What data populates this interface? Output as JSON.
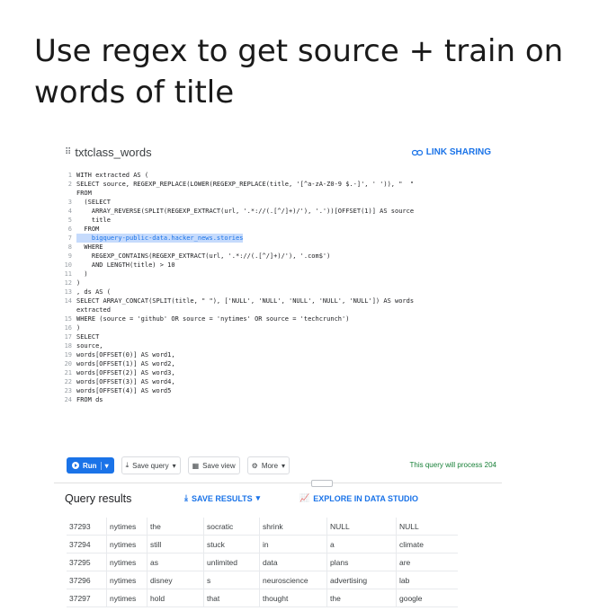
{
  "slide": {
    "title_line1": "Use regex to get source + train on",
    "title_line2": "words of title"
  },
  "editor": {
    "title": "txtclass_words",
    "link_sharing": "LINK SHARING",
    "code_lines": [
      {
        "n": "1",
        "t": "WITH extracted AS ("
      },
      {
        "n": "2",
        "t": "SELECT source, REGEXP_REPLACE(LOWER(REGEXP_REPLACE(title, '[^a-zA-Z0-9 $.-]', ' ')), \"  \""
      },
      {
        "n": "",
        "t": "FROM"
      },
      {
        "n": "3",
        "t": "  (SELECT"
      },
      {
        "n": "4",
        "t": "    ARRAY_REVERSE(SPLIT(REGEXP_EXTRACT(url, '.*://(.[^/]+)/'), '.'))[OFFSET(1)] AS source"
      },
      {
        "n": "5",
        "t": "    title"
      },
      {
        "n": "6",
        "t": "  FROM"
      },
      {
        "n": "7",
        "t": "    bigquery-public-data.hacker_news.stories",
        "hl": true
      },
      {
        "n": "8",
        "t": "  WHERE"
      },
      {
        "n": "9",
        "t": "    REGEXP_CONTAINS(REGEXP_EXTRACT(url, '.*://(.[^/]+)/'), '.com$')"
      },
      {
        "n": "10",
        "t": "    AND LENGTH(title) > 10"
      },
      {
        "n": "11",
        "t": "  )"
      },
      {
        "n": "12",
        "t": ")"
      },
      {
        "n": "13",
        "t": ", ds AS ("
      },
      {
        "n": "14",
        "t": "SELECT ARRAY_CONCAT(SPLIT(title, \" \"), ['NULL', 'NULL', 'NULL', 'NULL', 'NULL']) AS words"
      },
      {
        "n": "",
        "t": "extracted"
      },
      {
        "n": "15",
        "t": "WHERE (source = 'github' OR source = 'nytimes' OR source = 'techcrunch')"
      },
      {
        "n": "16",
        "t": ")"
      },
      {
        "n": "17",
        "t": "SELECT"
      },
      {
        "n": "18",
        "t": "source,"
      },
      {
        "n": "19",
        "t": "words[OFFSET(0)] AS word1,"
      },
      {
        "n": "20",
        "t": "words[OFFSET(1)] AS word2,"
      },
      {
        "n": "21",
        "t": "words[OFFSET(2)] AS word3,"
      },
      {
        "n": "22",
        "t": "words[OFFSET(3)] AS word4,"
      },
      {
        "n": "23",
        "t": "words[OFFSET(4)] AS word5"
      },
      {
        "n": "24",
        "t": "FROM ds"
      }
    ]
  },
  "toolbar": {
    "run": "Run",
    "save_query": "Save query",
    "save_view": "Save view",
    "more": "More",
    "process_note": "This query will process 204"
  },
  "results": {
    "title": "Query results",
    "save_results": "SAVE RESULTS",
    "explore": "EXPLORE IN DATA STUDIO",
    "rows": [
      [
        "37293",
        "nytimes",
        "the",
        "socratic",
        "shrink",
        "NULL",
        "NULL"
      ],
      [
        "37294",
        "nytimes",
        "still",
        "stuck",
        "in",
        "a",
        "climate"
      ],
      [
        "37295",
        "nytimes",
        "as",
        "unlimited",
        "data",
        "plans",
        "are"
      ],
      [
        "37296",
        "nytimes",
        "disney",
        "s",
        "neuroscience",
        "advertising",
        "lab"
      ],
      [
        "37297",
        "nytimes",
        "hold",
        "that",
        "thought",
        "the",
        "google"
      ]
    ]
  },
  "colors": {
    "accent": "#1a73e8",
    "process_note": "#188038"
  }
}
